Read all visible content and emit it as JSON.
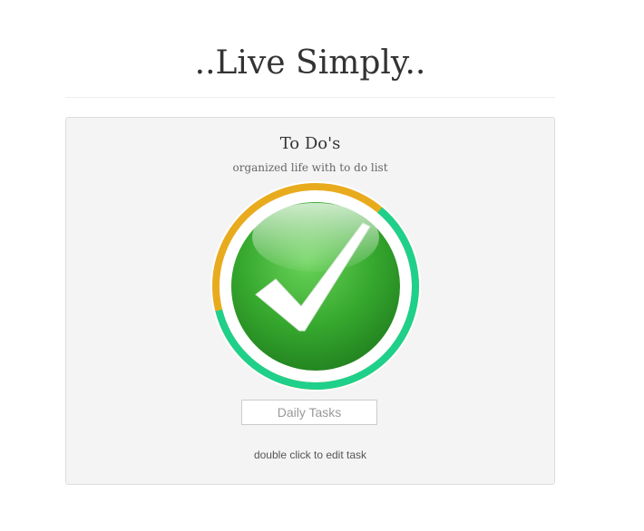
{
  "header": {
    "title": "..Live Simply.."
  },
  "todo_panel": {
    "heading": "To Do's",
    "subheading": "organized life with to do list",
    "task_input": {
      "value": "",
      "placeholder": "Daily Tasks"
    },
    "hint": "double click to edit task",
    "progress": {
      "icon": "checkmark-icon",
      "completed_fraction": 0.6,
      "completed_color": "#1fd08b",
      "remaining_color": "#e9ab1e"
    }
  },
  "colors": {
    "panel_background": "#f4f4f4",
    "check_green": "#2e9e2a"
  }
}
